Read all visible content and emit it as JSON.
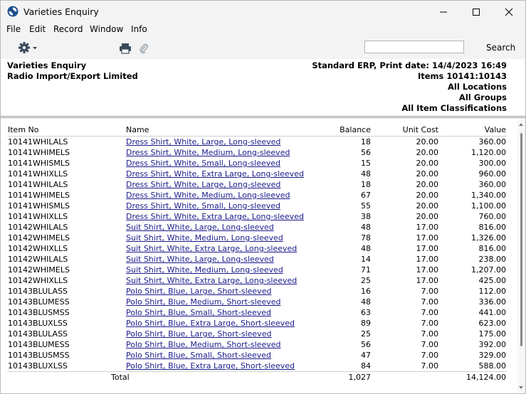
{
  "window": {
    "title": "Varieties Enquiry"
  },
  "menu": {
    "file": "File",
    "edit": "Edit",
    "record": "Record",
    "window": "Window",
    "info": "Info"
  },
  "toolbar": {
    "search_value": "",
    "search_label": "Search"
  },
  "header": {
    "left_title": "Varieties Enquiry",
    "company": "Radio Import/Export Limited",
    "print_info": "Standard ERP, Print date:  14/4/2023 16:49",
    "items": "Items  10141:10143",
    "locations": "All Locations",
    "groups": "All Groups",
    "classifications": "All Item Classifications"
  },
  "table": {
    "columns": {
      "item_no": "Item No",
      "name": "Name",
      "balance": "Balance",
      "unit_cost": "Unit Cost",
      "value": "Value"
    },
    "rows": [
      {
        "item_no": "10141WHILALS",
        "name": "Dress Shirt, White, Large, Long-sleeved",
        "balance": "18",
        "unit_cost": "20.00",
        "value": "360.00"
      },
      {
        "item_no": "10141WHIMELS",
        "name": "Dress Shirt, White, Medium, Long-sleeved",
        "balance": "56",
        "unit_cost": "20.00",
        "value": "1,120.00"
      },
      {
        "item_no": "10141WHISMLS",
        "name": "Dress Shirt, White, Small, Long-sleeved",
        "balance": "15",
        "unit_cost": "20.00",
        "value": "300.00"
      },
      {
        "item_no": "10141WHIXLLS",
        "name": "Dress Shirt, White, Extra Large, Long-sleeved",
        "balance": "48",
        "unit_cost": "20.00",
        "value": "960.00"
      },
      {
        "item_no": "10141WHILALS",
        "name": "Dress Shirt, White, Large, Long-sleeved",
        "balance": "18",
        "unit_cost": "20.00",
        "value": "360.00"
      },
      {
        "item_no": "10141WHIMELS",
        "name": "Dress Shirt, White, Medium, Long-sleeved",
        "balance": "67",
        "unit_cost": "20.00",
        "value": "1,340.00"
      },
      {
        "item_no": "10141WHISMLS",
        "name": "Dress Shirt, White, Small, Long-sleeved",
        "balance": "55",
        "unit_cost": "20.00",
        "value": "1,100.00"
      },
      {
        "item_no": "10141WHIXLLS",
        "name": "Dress Shirt, White, Extra Large, Long-sleeved",
        "balance": "38",
        "unit_cost": "20.00",
        "value": "760.00"
      },
      {
        "item_no": "10142WHILALS",
        "name": "Suit Shirt, White, Large, Long-sleeved",
        "balance": "48",
        "unit_cost": "17.00",
        "value": "816.00"
      },
      {
        "item_no": "10142WHIMELS",
        "name": "Suit Shirt, White, Medium, Long-sleeved",
        "balance": "78",
        "unit_cost": "17.00",
        "value": "1,326.00"
      },
      {
        "item_no": "10142WHIXLLS",
        "name": "Suit Shirt, White, Extra Large, Long-sleeved",
        "balance": "48",
        "unit_cost": "17.00",
        "value": "816.00"
      },
      {
        "item_no": "10142WHILALS",
        "name": "Suit Shirt, White, Large, Long-sleeved",
        "balance": "14",
        "unit_cost": "17.00",
        "value": "238.00"
      },
      {
        "item_no": "10142WHIMELS",
        "name": "Suit Shirt, White, Medium, Long-sleeved",
        "balance": "71",
        "unit_cost": "17.00",
        "value": "1,207.00"
      },
      {
        "item_no": "10142WHIXLLS",
        "name": "Suit Shirt, White, Extra Large, Long-sleeved",
        "balance": "25",
        "unit_cost": "17.00",
        "value": "425.00"
      },
      {
        "item_no": "10143BLULASS",
        "name": "Polo Shirt, Blue, Large, Short-sleeved",
        "balance": "16",
        "unit_cost": "7.00",
        "value": "112.00"
      },
      {
        "item_no": "10143BLUMESS",
        "name": "Polo Shirt, Blue, Medium, Short-sleeved",
        "balance": "48",
        "unit_cost": "7.00",
        "value": "336.00"
      },
      {
        "item_no": "10143BLUSMSS",
        "name": "Polo Shirt, Blue, Small, Short-sleeved",
        "balance": "63",
        "unit_cost": "7.00",
        "value": "441.00"
      },
      {
        "item_no": "10143BLUXLSS",
        "name": "Polo Shirt, Blue, Extra Large, Short-sleeved",
        "balance": "89",
        "unit_cost": "7.00",
        "value": "623.00"
      },
      {
        "item_no": "10143BLULASS",
        "name": "Polo Shirt, Blue, Large, Short-sleeved",
        "balance": "25",
        "unit_cost": "7.00",
        "value": "175.00"
      },
      {
        "item_no": "10143BLUMESS",
        "name": "Polo Shirt, Blue, Medium, Short-sleeved",
        "balance": "56",
        "unit_cost": "7.00",
        "value": "392.00"
      },
      {
        "item_no": "10143BLUSMSS",
        "name": "Polo Shirt, Blue, Small, Short-sleeved",
        "balance": "47",
        "unit_cost": "7.00",
        "value": "329.00"
      },
      {
        "item_no": "10143BLUXLSS",
        "name": "Polo Shirt, Blue, Extra Large, Short-sleeved",
        "balance": "84",
        "unit_cost": "7.00",
        "value": "588.00"
      }
    ],
    "total": {
      "label": "Total",
      "balance": "1,027",
      "value": "14,124.00"
    }
  },
  "icons": {
    "app": "app-icon",
    "minimize": "minimize-icon",
    "maximize": "maximize-icon",
    "close": "close-icon",
    "gear": "gear-icon",
    "printer": "printer-icon",
    "attachment": "paperclip-icon"
  }
}
